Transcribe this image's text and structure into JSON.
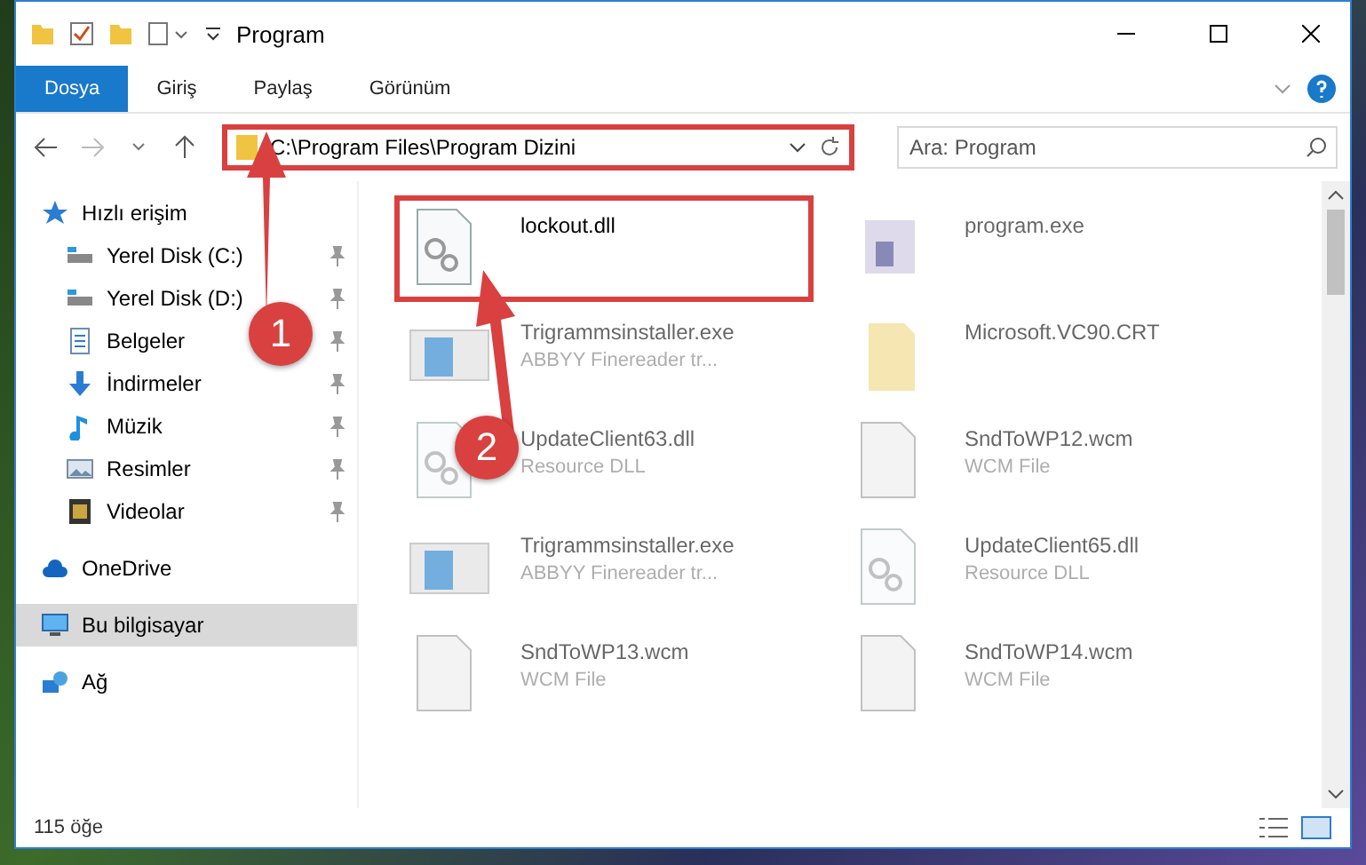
{
  "window": {
    "title": "Program"
  },
  "ribbon_tabs": [
    {
      "label": "Dosya",
      "selected": true
    },
    {
      "label": "Giriş",
      "selected": false
    },
    {
      "label": "Paylaş",
      "selected": false
    },
    {
      "label": "Görünüm",
      "selected": false
    }
  ],
  "address": {
    "path": "C:\\Program Files\\Program Dizini",
    "highlighted": true
  },
  "search": {
    "placeholder": "Ara: Program"
  },
  "sidebar": {
    "items": [
      {
        "label": "Hızlı erişim",
        "kind": "star",
        "pinned": false,
        "selected": false,
        "children": [
          {
            "label": "Yerel Disk (C:)",
            "kind": "drive",
            "pinned": true,
            "selected": false
          },
          {
            "label": "Yerel Disk (D:)",
            "kind": "drive",
            "pinned": true,
            "selected": false
          },
          {
            "label": "Belgeler",
            "kind": "doc",
            "pinned": true,
            "selected": false
          },
          {
            "label": "İndirmeler",
            "kind": "download",
            "pinned": true,
            "selected": false
          },
          {
            "label": "Müzik",
            "kind": "music",
            "pinned": true,
            "selected": false
          },
          {
            "label": "Resimler",
            "kind": "picture",
            "pinned": true,
            "selected": false
          },
          {
            "label": "Videolar",
            "kind": "video",
            "pinned": true,
            "selected": false
          }
        ]
      },
      {
        "label": "OneDrive",
        "kind": "cloud",
        "pinned": false,
        "selected": false
      },
      {
        "label": "Bu bilgisayar",
        "kind": "pc",
        "pinned": false,
        "selected": true
      },
      {
        "label": "Ağ",
        "kind": "network",
        "pinned": false,
        "selected": false
      }
    ]
  },
  "files": [
    {
      "name": "lockout.dll",
      "kind": "dll",
      "dimmed": false,
      "highlighted": true
    },
    {
      "name": "program.exe",
      "kind": "exe",
      "dimmed": true,
      "highlighted": false
    },
    {
      "name": "Trigrammsinstaller.exe",
      "type": "ABBYY Finereader tr...",
      "kind": "installer",
      "dimmed": true,
      "highlighted": false
    },
    {
      "name": "Microsoft.VC90.CRT",
      "kind": "folder",
      "dimmed": true,
      "highlighted": false
    },
    {
      "name": "UpdateClient63.dll",
      "type": "Resource DLL",
      "kind": "dll",
      "dimmed": true,
      "highlighted": false
    },
    {
      "name": "SndToWP12.wcm",
      "type": "WCM File",
      "kind": "file",
      "dimmed": true,
      "highlighted": false
    },
    {
      "name": "Trigrammsinstaller.exe",
      "type": "ABBYY Finereader tr...",
      "kind": "installer",
      "dimmed": true,
      "highlighted": false
    },
    {
      "name": "UpdateClient65.dll",
      "type": "Resource DLL",
      "kind": "dll",
      "dimmed": true,
      "highlighted": false
    },
    {
      "name": "SndToWP13.wcm",
      "type": "WCM File",
      "kind": "file",
      "dimmed": true,
      "highlighted": false
    },
    {
      "name": "SndToWP14.wcm",
      "type": "WCM File",
      "kind": "file",
      "dimmed": true,
      "highlighted": false
    }
  ],
  "status_bar": {
    "count": "115 öğe"
  },
  "annotations": [
    {
      "label": "1"
    },
    {
      "label": "2"
    }
  ]
}
